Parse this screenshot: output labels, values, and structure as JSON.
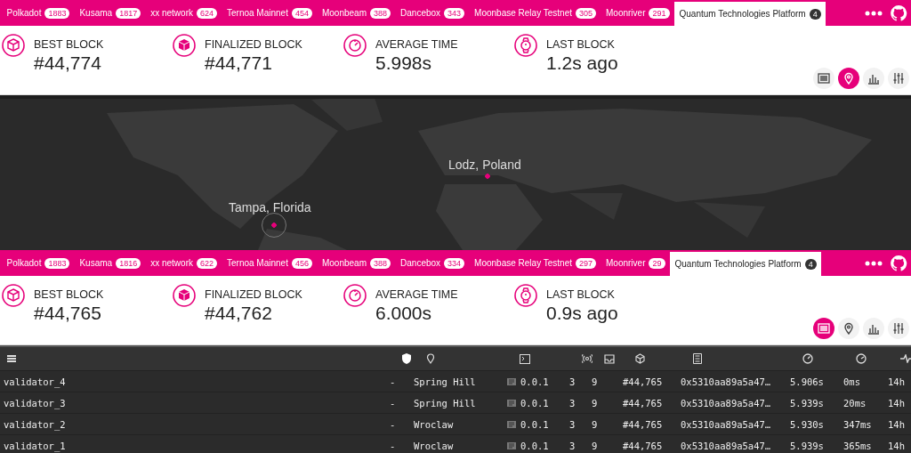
{
  "panels": [
    {
      "tabs": [
        {
          "label": "Polkadot",
          "count": "1883",
          "selected": false
        },
        {
          "label": "Kusama",
          "count": "1817",
          "selected": false
        },
        {
          "label": "xx network",
          "count": "624",
          "selected": false
        },
        {
          "label": "Ternoa Mainnet",
          "count": "454",
          "selected": false
        },
        {
          "label": "Moonbeam",
          "count": "388",
          "selected": false
        },
        {
          "label": "Dancebox",
          "count": "343",
          "selected": false
        },
        {
          "label": "Moonbase Relay Testnet",
          "count": "305",
          "selected": false
        },
        {
          "label": "Moonriver",
          "count": "291",
          "selected": false
        },
        {
          "label": "Quantum Technologies Platform",
          "count": "4",
          "selected": true
        }
      ],
      "stats": [
        {
          "kind": "best",
          "label": "BEST BLOCK",
          "value": "#44,774"
        },
        {
          "kind": "finalized",
          "label": "FINALIZED BLOCK",
          "value": "#44,771"
        },
        {
          "kind": "average",
          "label": "AVERAGE TIME",
          "value": "5.998s"
        },
        {
          "kind": "last",
          "label": "LAST BLOCK",
          "value": "1.2s ago"
        }
      ],
      "views": [
        {
          "kind": "list",
          "selected": false
        },
        {
          "kind": "map",
          "selected": true
        },
        {
          "kind": "chart",
          "selected": false
        },
        {
          "kind": "settings",
          "selected": false
        }
      ],
      "map": {
        "markers": [
          {
            "label": "Lodz, Poland",
            "selected": false
          },
          {
            "label": "Tampa, Florida",
            "selected": true
          }
        ]
      }
    },
    {
      "tabs": [
        {
          "label": "Polkadot",
          "count": "1883",
          "selected": false
        },
        {
          "label": "Kusama",
          "count": "1816",
          "selected": false
        },
        {
          "label": "xx network",
          "count": "622",
          "selected": false
        },
        {
          "label": "Ternoa Mainnet",
          "count": "456",
          "selected": false
        },
        {
          "label": "Moonbeam",
          "count": "388",
          "selected": false
        },
        {
          "label": "Dancebox",
          "count": "334",
          "selected": false
        },
        {
          "label": "Moonbase Relay Testnet",
          "count": "297",
          "selected": false
        },
        {
          "label": "Moonriver",
          "count": "29",
          "selected": false
        },
        {
          "label": "Quantum Technologies Platform",
          "count": "4",
          "selected": true
        }
      ],
      "stats": [
        {
          "kind": "best",
          "label": "BEST BLOCK",
          "value": "#44,765"
        },
        {
          "kind": "finalized",
          "label": "FINALIZED BLOCK",
          "value": "#44,762"
        },
        {
          "kind": "average",
          "label": "AVERAGE TIME",
          "value": "6.000s"
        },
        {
          "kind": "last",
          "label": "LAST BLOCK",
          "value": "0.9s ago"
        }
      ],
      "views": [
        {
          "kind": "list",
          "selected": true
        },
        {
          "kind": "map",
          "selected": false
        },
        {
          "kind": "chart",
          "selected": false
        },
        {
          "kind": "settings",
          "selected": false
        }
      ],
      "table": {
        "rows": [
          {
            "name": "validator_4",
            "validator": "-",
            "location": "Spring Hill",
            "implementation": "0.0.1",
            "peers": "3",
            "txs": "9",
            "block": "#44,765",
            "hash": "0x5310aa89a5a47…",
            "time": "5.906s",
            "propagation": "0ms",
            "uptime": "14h"
          },
          {
            "name": "validator_3",
            "validator": "-",
            "location": "Spring Hill",
            "implementation": "0.0.1",
            "peers": "3",
            "txs": "9",
            "block": "#44,765",
            "hash": "0x5310aa89a5a47…",
            "time": "5.939s",
            "propagation": "20ms",
            "uptime": "14h"
          },
          {
            "name": "validator_2",
            "validator": "-",
            "location": "Wroclaw",
            "implementation": "0.0.1",
            "peers": "3",
            "txs": "9",
            "block": "#44,765",
            "hash": "0x5310aa89a5a47…",
            "time": "5.930s",
            "propagation": "347ms",
            "uptime": "14h"
          },
          {
            "name": "validator_1",
            "validator": "-",
            "location": "Wroclaw",
            "implementation": "0.0.1",
            "peers": "3",
            "txs": "9",
            "block": "#44,765",
            "hash": "0x5310aa89a5a47…",
            "time": "5.939s",
            "propagation": "365ms",
            "uptime": "14h"
          }
        ]
      }
    }
  ]
}
